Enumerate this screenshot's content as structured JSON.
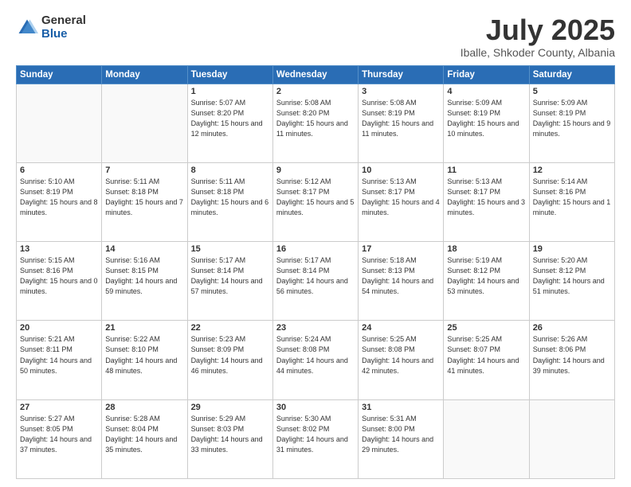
{
  "header": {
    "logo_general": "General",
    "logo_blue": "Blue",
    "month_title": "July 2025",
    "subtitle": "Iballe, Shkoder County, Albania"
  },
  "weekdays": [
    "Sunday",
    "Monday",
    "Tuesday",
    "Wednesday",
    "Thursday",
    "Friday",
    "Saturday"
  ],
  "weeks": [
    [
      {
        "day": "",
        "info": ""
      },
      {
        "day": "",
        "info": ""
      },
      {
        "day": "1",
        "info": "Sunrise: 5:07 AM\nSunset: 8:20 PM\nDaylight: 15 hours and 12 minutes."
      },
      {
        "day": "2",
        "info": "Sunrise: 5:08 AM\nSunset: 8:20 PM\nDaylight: 15 hours and 11 minutes."
      },
      {
        "day": "3",
        "info": "Sunrise: 5:08 AM\nSunset: 8:19 PM\nDaylight: 15 hours and 11 minutes."
      },
      {
        "day": "4",
        "info": "Sunrise: 5:09 AM\nSunset: 8:19 PM\nDaylight: 15 hours and 10 minutes."
      },
      {
        "day": "5",
        "info": "Sunrise: 5:09 AM\nSunset: 8:19 PM\nDaylight: 15 hours and 9 minutes."
      }
    ],
    [
      {
        "day": "6",
        "info": "Sunrise: 5:10 AM\nSunset: 8:19 PM\nDaylight: 15 hours and 8 minutes."
      },
      {
        "day": "7",
        "info": "Sunrise: 5:11 AM\nSunset: 8:18 PM\nDaylight: 15 hours and 7 minutes."
      },
      {
        "day": "8",
        "info": "Sunrise: 5:11 AM\nSunset: 8:18 PM\nDaylight: 15 hours and 6 minutes."
      },
      {
        "day": "9",
        "info": "Sunrise: 5:12 AM\nSunset: 8:17 PM\nDaylight: 15 hours and 5 minutes."
      },
      {
        "day": "10",
        "info": "Sunrise: 5:13 AM\nSunset: 8:17 PM\nDaylight: 15 hours and 4 minutes."
      },
      {
        "day": "11",
        "info": "Sunrise: 5:13 AM\nSunset: 8:17 PM\nDaylight: 15 hours and 3 minutes."
      },
      {
        "day": "12",
        "info": "Sunrise: 5:14 AM\nSunset: 8:16 PM\nDaylight: 15 hours and 1 minute."
      }
    ],
    [
      {
        "day": "13",
        "info": "Sunrise: 5:15 AM\nSunset: 8:16 PM\nDaylight: 15 hours and 0 minutes."
      },
      {
        "day": "14",
        "info": "Sunrise: 5:16 AM\nSunset: 8:15 PM\nDaylight: 14 hours and 59 minutes."
      },
      {
        "day": "15",
        "info": "Sunrise: 5:17 AM\nSunset: 8:14 PM\nDaylight: 14 hours and 57 minutes."
      },
      {
        "day": "16",
        "info": "Sunrise: 5:17 AM\nSunset: 8:14 PM\nDaylight: 14 hours and 56 minutes."
      },
      {
        "day": "17",
        "info": "Sunrise: 5:18 AM\nSunset: 8:13 PM\nDaylight: 14 hours and 54 minutes."
      },
      {
        "day": "18",
        "info": "Sunrise: 5:19 AM\nSunset: 8:12 PM\nDaylight: 14 hours and 53 minutes."
      },
      {
        "day": "19",
        "info": "Sunrise: 5:20 AM\nSunset: 8:12 PM\nDaylight: 14 hours and 51 minutes."
      }
    ],
    [
      {
        "day": "20",
        "info": "Sunrise: 5:21 AM\nSunset: 8:11 PM\nDaylight: 14 hours and 50 minutes."
      },
      {
        "day": "21",
        "info": "Sunrise: 5:22 AM\nSunset: 8:10 PM\nDaylight: 14 hours and 48 minutes."
      },
      {
        "day": "22",
        "info": "Sunrise: 5:23 AM\nSunset: 8:09 PM\nDaylight: 14 hours and 46 minutes."
      },
      {
        "day": "23",
        "info": "Sunrise: 5:24 AM\nSunset: 8:08 PM\nDaylight: 14 hours and 44 minutes."
      },
      {
        "day": "24",
        "info": "Sunrise: 5:25 AM\nSunset: 8:08 PM\nDaylight: 14 hours and 42 minutes."
      },
      {
        "day": "25",
        "info": "Sunrise: 5:25 AM\nSunset: 8:07 PM\nDaylight: 14 hours and 41 minutes."
      },
      {
        "day": "26",
        "info": "Sunrise: 5:26 AM\nSunset: 8:06 PM\nDaylight: 14 hours and 39 minutes."
      }
    ],
    [
      {
        "day": "27",
        "info": "Sunrise: 5:27 AM\nSunset: 8:05 PM\nDaylight: 14 hours and 37 minutes."
      },
      {
        "day": "28",
        "info": "Sunrise: 5:28 AM\nSunset: 8:04 PM\nDaylight: 14 hours and 35 minutes."
      },
      {
        "day": "29",
        "info": "Sunrise: 5:29 AM\nSunset: 8:03 PM\nDaylight: 14 hours and 33 minutes."
      },
      {
        "day": "30",
        "info": "Sunrise: 5:30 AM\nSunset: 8:02 PM\nDaylight: 14 hours and 31 minutes."
      },
      {
        "day": "31",
        "info": "Sunrise: 5:31 AM\nSunset: 8:00 PM\nDaylight: 14 hours and 29 minutes."
      },
      {
        "day": "",
        "info": ""
      },
      {
        "day": "",
        "info": ""
      }
    ]
  ]
}
